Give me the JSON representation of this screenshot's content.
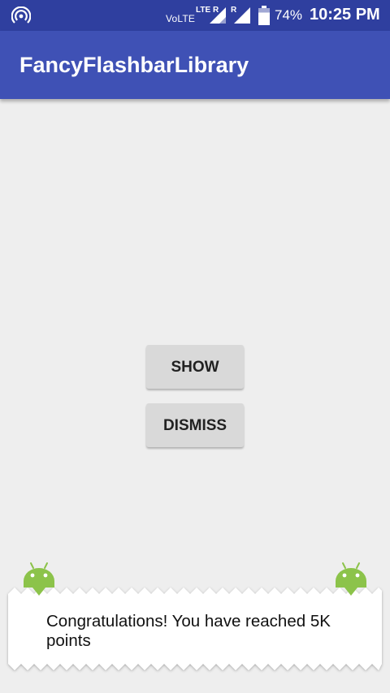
{
  "status_bar": {
    "network_label": "VoLTE",
    "lte_label": "LTE",
    "roaming_1": "R",
    "roaming_2": "R",
    "battery_percent": "74%",
    "time": "10:25 PM",
    "icons": [
      "hotspot-icon",
      "signal-icon",
      "battery-icon"
    ]
  },
  "app_bar": {
    "title": "FancyFlashbarLibrary",
    "color": "#3f51b5"
  },
  "buttons": {
    "show_label": "SHOW",
    "dismiss_label": "DISMISS"
  },
  "flashbar": {
    "message": "Congratulations! You have reached 5K points",
    "icon": "android-icon",
    "icon_color": "#8cc34a"
  }
}
